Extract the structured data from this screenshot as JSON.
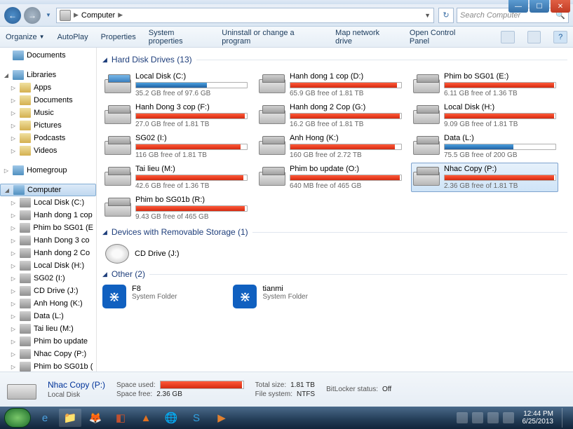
{
  "window": {
    "title": "Computer"
  },
  "breadcrumb": {
    "location": "Computer"
  },
  "search": {
    "placeholder": "Search Computer"
  },
  "toolbar": {
    "organize": "Organize",
    "autoplay": "AutoPlay",
    "properties": "Properties",
    "system_properties": "System properties",
    "uninstall": "Uninstall or change a program",
    "map_drive": "Map network drive",
    "control_panel": "Open Control Panel"
  },
  "sidebar": {
    "documents": "Documents",
    "libraries": "Libraries",
    "lib_items": [
      "Apps",
      "Documents",
      "Music",
      "Pictures",
      "Podcasts",
      "Videos"
    ],
    "homegroup": "Homegroup",
    "computer": "Computer",
    "drives": [
      "Local Disk (C:)",
      "Hanh dong 1 cop",
      "Phim bo SG01 (E",
      "Hanh Dong 3 co",
      "Hanh dong 2 Co",
      "Local Disk (H:)",
      "SG02 (I:)",
      "CD Drive (J:)",
      "Anh Hong (K:)",
      "Data (L:)",
      "Tai lieu (M:)",
      "Phim bo update",
      "Nhac Copy (P:)",
      "Phim bo SG01b ("
    ]
  },
  "groups": {
    "hdd": "Hard Disk Drives (13)",
    "removable": "Devices with Removable Storage (1)",
    "other": "Other (2)"
  },
  "drives": [
    {
      "name": "Local Disk (C:)",
      "free": "35.2 GB free of 97.6 GB",
      "pct": 64,
      "color": "blue",
      "sys": true
    },
    {
      "name": "Hanh dong 1 cop (D:)",
      "free": "65.9 GB free of 1.81 TB",
      "pct": 96,
      "color": "red"
    },
    {
      "name": "Phim bo SG01 (E:)",
      "free": "6.11 GB free of 1.36 TB",
      "pct": 99,
      "color": "red"
    },
    {
      "name": "Hanh Dong 3 cop (F:)",
      "free": "27.0 GB free of 1.81 TB",
      "pct": 98,
      "color": "red"
    },
    {
      "name": "Hanh dong 2 Cop (G:)",
      "free": "16.2 GB free of 1.81 TB",
      "pct": 99,
      "color": "red"
    },
    {
      "name": "Local Disk (H:)",
      "free": "9.09 GB free of 1.81 TB",
      "pct": 99,
      "color": "red"
    },
    {
      "name": "SG02 (I:)",
      "free": "116 GB free of 1.81 TB",
      "pct": 94,
      "color": "red"
    },
    {
      "name": "Anh Hong (K:)",
      "free": "160 GB free of 2.72 TB",
      "pct": 94,
      "color": "red"
    },
    {
      "name": "Data (L:)",
      "free": "75.5 GB free of 200 GB",
      "pct": 62,
      "color": "blue"
    },
    {
      "name": "Tai lieu (M:)",
      "free": "42.6 GB free of 1.36 TB",
      "pct": 97,
      "color": "red"
    },
    {
      "name": "Phim bo update (O:)",
      "free": "640 MB free of 465 GB",
      "pct": 99,
      "color": "red"
    },
    {
      "name": "Nhac Copy (P:)",
      "free": "2.36 GB free of 1.81 TB",
      "pct": 99,
      "color": "red",
      "selected": true
    },
    {
      "name": "Phim bo SG01b (R:)",
      "free": "9.43 GB free of 465 GB",
      "pct": 98,
      "color": "red"
    }
  ],
  "cd": {
    "name": "CD Drive (J:)"
  },
  "other_items": [
    {
      "name": "F8",
      "sub": "System Folder"
    },
    {
      "name": "tianmi",
      "sub": "System Folder"
    }
  ],
  "details": {
    "title": "Nhac Copy (P:)",
    "subtitle": "Local Disk",
    "space_used_label": "Space used:",
    "space_free_label": "Space free:",
    "space_free": "2.36 GB",
    "total_size_label": "Total size:",
    "total_size": "1.81 TB",
    "file_system_label": "File system:",
    "file_system": "NTFS",
    "bitlocker_label": "BitLocker status:",
    "bitlocker": "Off"
  },
  "taskbar": {
    "time": "12:44 PM",
    "date": "6/25/2013"
  }
}
